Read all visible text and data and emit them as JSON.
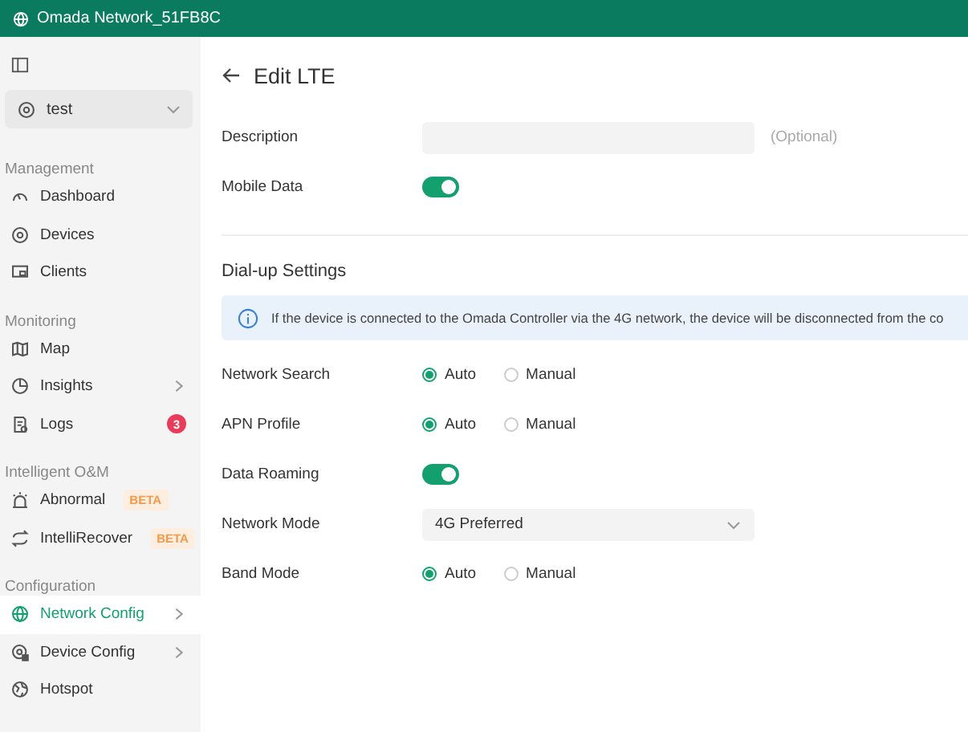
{
  "header": {
    "title": "Omada Network_51FB8C"
  },
  "sidebar": {
    "site": "test",
    "sections": [
      {
        "title": "Management",
        "items": [
          {
            "label": "Dashboard",
            "selected": false,
            "has_submenu": false
          },
          {
            "label": "Devices",
            "selected": false,
            "has_submenu": false
          },
          {
            "label": "Clients",
            "selected": false,
            "has_submenu": false
          }
        ]
      },
      {
        "title": "Monitoring",
        "items": [
          {
            "label": "Map",
            "selected": false,
            "has_submenu": false
          },
          {
            "label": "Insights",
            "selected": false,
            "has_submenu": true
          },
          {
            "label": "Logs",
            "selected": false,
            "has_submenu": false,
            "badge": "3"
          }
        ]
      },
      {
        "title": "Intelligent O&M",
        "items": [
          {
            "label": "Abnormal",
            "selected": false,
            "has_submenu": false,
            "tag": "BETA"
          },
          {
            "label": "IntelliRecover",
            "selected": false,
            "has_submenu": false,
            "tag": "BETA"
          }
        ]
      },
      {
        "title": "Configuration",
        "items": [
          {
            "label": "Network Config",
            "selected": true,
            "has_submenu": true
          },
          {
            "label": "Device Config",
            "selected": false,
            "has_submenu": true
          },
          {
            "label": "Hotspot",
            "selected": false,
            "has_submenu": false
          }
        ]
      }
    ]
  },
  "page": {
    "title": "Edit LTE",
    "sections": [
      {
        "fields": [
          {
            "kind": "text",
            "label": "Description",
            "hint": "(Optional)"
          },
          {
            "kind": "toggle",
            "label": "Mobile Data",
            "on": true
          }
        ]
      },
      {
        "title": "Dial-up Settings",
        "notice": "If the device is connected to the Omada Controller via the 4G network, the device will be disconnected from the co",
        "fields": [
          {
            "kind": "radio",
            "label": "Network Search",
            "options": [
              {
                "label": "Auto",
                "selected": true
              },
              {
                "label": "Manual",
                "selected": false
              }
            ]
          },
          {
            "kind": "radio",
            "label": "APN Profile",
            "options": [
              {
                "label": "Auto",
                "selected": true
              },
              {
                "label": "Manual",
                "selected": false
              }
            ]
          },
          {
            "kind": "toggle",
            "label": "Data Roaming",
            "on": true
          },
          {
            "kind": "select",
            "label": "Network Mode",
            "value": "4G Preferred"
          },
          {
            "kind": "radio",
            "label": "Band Mode",
            "options": [
              {
                "label": "Auto",
                "selected": true
              },
              {
                "label": "Manual",
                "selected": false
              }
            ]
          }
        ]
      }
    ]
  }
}
